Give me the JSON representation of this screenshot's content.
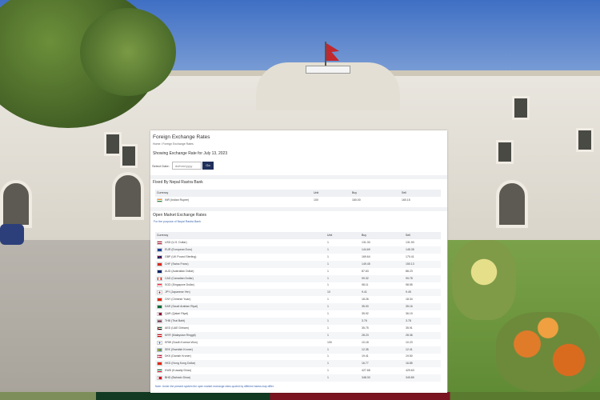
{
  "page": {
    "title": "Foreign Exchange Rates",
    "breadcrumb": "Home / Foreign Exchange Rates",
    "showing": "Showing Exchange Rate for July 13, 2023",
    "select_date_label": "Select Date:",
    "date_placeholder": "dd/mm/yyyy",
    "go_label": "Go"
  },
  "fixed": {
    "title": "Fixed By Nepal Rastra Bank",
    "headers": {
      "currency": "Currency",
      "unit": "Unit",
      "buy": "Buy",
      "sell": "Sell"
    },
    "rows": [
      {
        "currency": "INR (Indian Rupee)",
        "unit": "100",
        "buy": "160.00",
        "sell": "160.15",
        "flag": "india-flag"
      }
    ]
  },
  "open": {
    "title": "Open Market Exchange Rates",
    "subtitle": "For the purpose of Nepal Rastra Bank",
    "headers": {
      "currency": "Currency",
      "unit": "Unit",
      "buy": "Buy",
      "sell": "Sell"
    },
    "rows": [
      {
        "currency": "USD (U.S. Dollar)",
        "unit": "1",
        "buy": "131.30",
        "sell": "131.90",
        "flag": "usa-flag"
      },
      {
        "currency": "EUR (European Euro)",
        "unit": "1",
        "buy": "144.69",
        "sell": "145.35",
        "flag": "eu-flag"
      },
      {
        "currency": "GBP (UK Pound Sterling)",
        "unit": "1",
        "buy": "169.64",
        "sell": "170.41",
        "flag": "uk-flag"
      },
      {
        "currency": "CHF (Swiss Franc)",
        "unit": "1",
        "buy": "149.45",
        "sell": "150.13",
        "flag": "swiss-flag"
      },
      {
        "currency": "AUD (Australian Dollar)",
        "unit": "1",
        "buy": "87.63",
        "sell": "88.23",
        "flag": "australia-flag"
      },
      {
        "currency": "CAD (Canadian Dollar)",
        "unit": "1",
        "buy": "99.32",
        "sell": "99.78",
        "flag": "canada-flag"
      },
      {
        "currency": "SGD (Singapore Dollar)",
        "unit": "1",
        "buy": "98.11",
        "sell": "98.55",
        "flag": "singapore-flag"
      },
      {
        "currency": "JPY (Japanese Yen)",
        "unit": "10",
        "buy": "9.41",
        "sell": "9.45",
        "flag": "japan-flag"
      },
      {
        "currency": "CNY (Chinese Yuan)",
        "unit": "1",
        "buy": "18.26",
        "sell": "18.34",
        "flag": "china-flag"
      },
      {
        "currency": "SAR (Saudi Arabian Riyal)",
        "unit": "1",
        "buy": "35.00",
        "sell": "35.16",
        "flag": "saudi-flag"
      },
      {
        "currency": "QAR (Qatari Riyal)",
        "unit": "1",
        "buy": "35.92",
        "sell": "36.19",
        "flag": "qatar-flag"
      },
      {
        "currency": "THB (Thai Baht)",
        "unit": "1",
        "buy": "3.76",
        "sell": "3.78",
        "flag": "thailand-flag"
      },
      {
        "currency": "AED (UAE Dirham)",
        "unit": "1",
        "buy": "35.75",
        "sell": "35.91",
        "flag": "uae-flag"
      },
      {
        "currency": "MYR (Malaysian Ringgit)",
        "unit": "1",
        "buy": "28.23",
        "sell": "28.36",
        "flag": "malaysia-flag"
      },
      {
        "currency": "KRW (South Korean Won)",
        "unit": "100",
        "buy": "10.18",
        "sell": "10.23",
        "flag": "korea-flag"
      },
      {
        "currency": "SEK (Swedish Kroner)",
        "unit": "1",
        "buy": "12.35",
        "sell": "12.41",
        "flag": "sweden-flag"
      },
      {
        "currency": "DKK (Danish Kroner)",
        "unit": "1",
        "buy": "19.41",
        "sell": "19.50",
        "flag": "denmark-flag"
      },
      {
        "currency": "HKD (Hong Kong Dollar)",
        "unit": "1",
        "buy": "16.77",
        "sell": "16.85",
        "flag": "hongkong-flag"
      },
      {
        "currency": "KWD (Kuwaity Dinar)",
        "unit": "1",
        "buy": "427.68",
        "sell": "429.63",
        "flag": "kuwait-flag"
      },
      {
        "currency": "BHD (Bahrain Dinar)",
        "unit": "1",
        "buy": "348.30",
        "sell": "349.89",
        "flag": "bahrain-flag"
      }
    ],
    "note": "Note: Under the present system the open market exchange rates quoted by different banks may differ."
  },
  "colors": {
    "accent": "#1f2f5b",
    "link": "#3c67b0"
  }
}
